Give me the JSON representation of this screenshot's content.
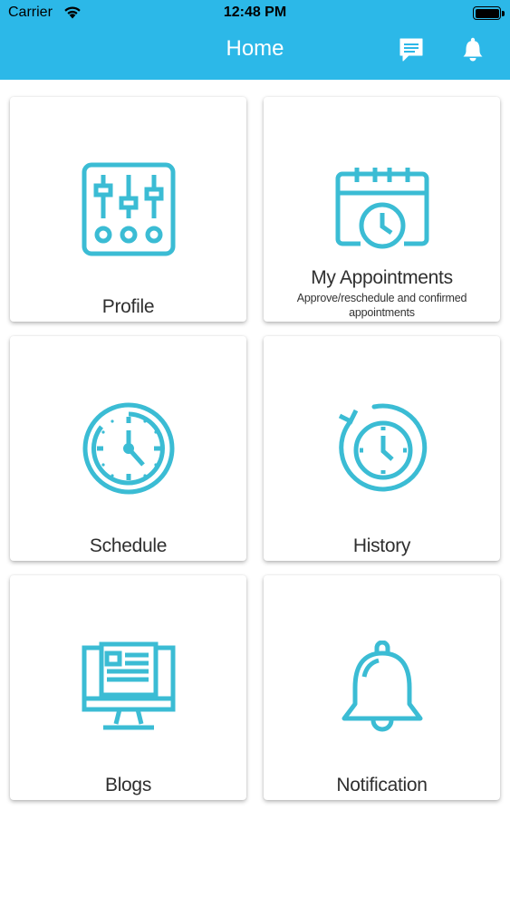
{
  "status_bar": {
    "carrier": "Carrier",
    "time": "12:48 PM",
    "wifi_icon": "wifi-icon",
    "battery_icon": "battery-icon"
  },
  "nav": {
    "title": "Home",
    "chat_icon": "chat-icon",
    "bell_icon": "bell-icon",
    "bar_color": "#2cb8e8"
  },
  "accent_color": "#3bbcd4",
  "cards": {
    "profile": {
      "label": "Profile",
      "icon": "sliders-icon"
    },
    "appointments": {
      "label": "My Appointments",
      "subtitle": "Approve/reschedule and confirmed appointments",
      "icon": "calendar-clock-icon"
    },
    "schedule": {
      "label": "Schedule",
      "icon": "clock-icon"
    },
    "history": {
      "label": "History",
      "icon": "history-icon"
    },
    "blogs": {
      "label": "Blogs",
      "icon": "monitor-article-icon"
    },
    "notification": {
      "label": "Notification",
      "icon": "bell-icon"
    }
  }
}
